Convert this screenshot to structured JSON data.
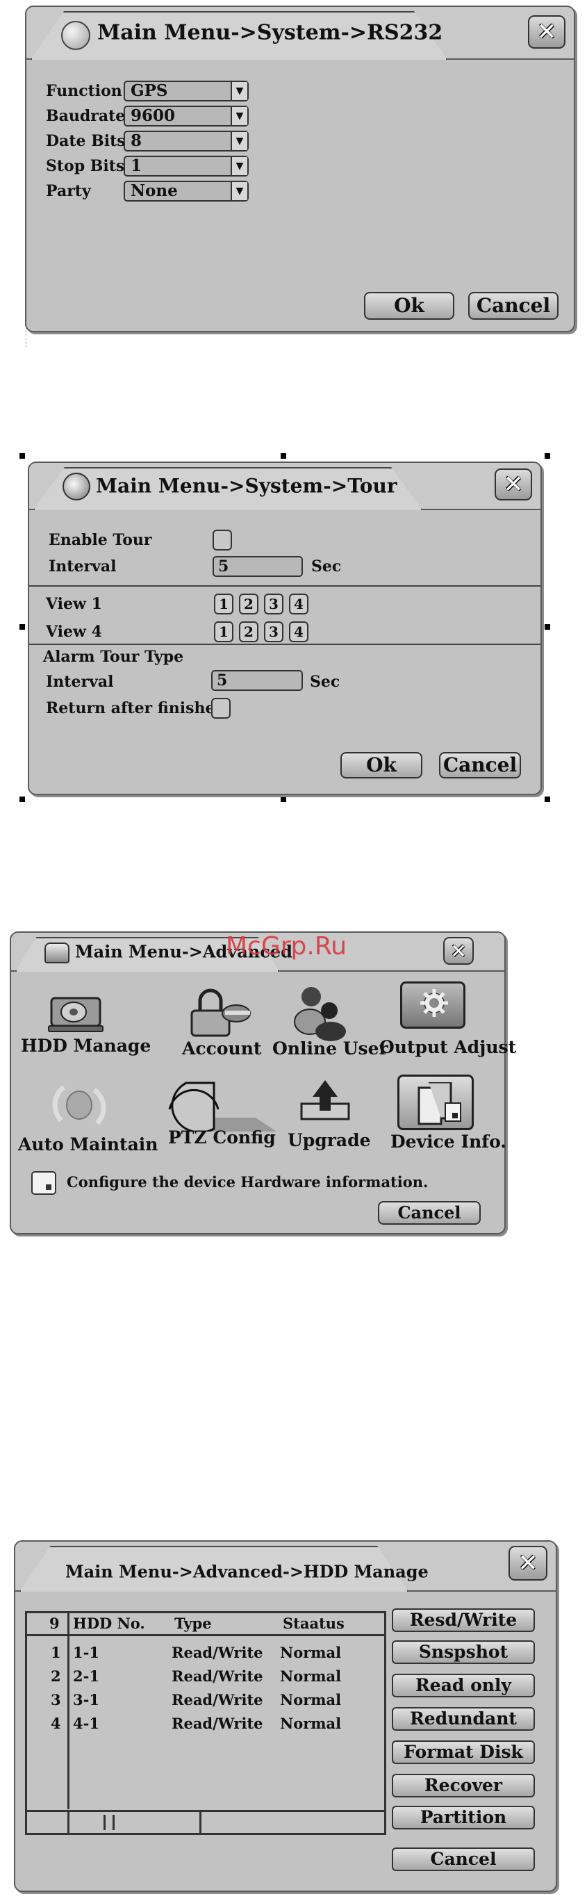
{
  "rs232": {
    "title": "Main Menu->System->RS232",
    "close_symbol": "✕",
    "fields": [
      {
        "label": "Function",
        "value": "GPS"
      },
      {
        "label": "Baudrate",
        "value": "9600"
      },
      {
        "label": "Date Bits",
        "value": "8"
      },
      {
        "label": "Stop Bits",
        "value": "1"
      },
      {
        "label": "Party",
        "value": "None"
      }
    ],
    "ok_label": "Ok",
    "cancel_label": "Cancel"
  },
  "tour": {
    "title": "Main Menu->System->Tour",
    "close_symbol": "✕",
    "enable_tour_label": "Enable Tour",
    "interval_label": "Interval",
    "interval_value": "5",
    "sec_label": "Sec",
    "view1_label": "View 1",
    "view4_label": "View 4",
    "view_numbers": [
      "1",
      "2",
      "3",
      "4"
    ],
    "alarm_tour_label": "Alarm Tour  Type",
    "alarm_interval_label": "Interval",
    "alarm_interval_value": "5",
    "alarm_sec_label": "Sec",
    "return_label": "Return after finished",
    "ok_label": "Ok",
    "cancel_label": "Cancel"
  },
  "advanced": {
    "title": "Main Menu->Advanced",
    "close_symbol": "✕",
    "items": [
      {
        "label": "HDD Manage",
        "icon": "hdd-icon"
      },
      {
        "label": "Account",
        "icon": "account-icon"
      },
      {
        "label": "Online User",
        "icon": "online-user-icon"
      },
      {
        "label": "Output Adjust",
        "icon": "output-adjust-icon"
      },
      {
        "label": "Auto Maintain",
        "icon": "auto-maintain-icon"
      },
      {
        "label": "PTZ Config",
        "icon": "ptz-config-icon"
      },
      {
        "label": "Upgrade",
        "icon": "upgrade-icon"
      },
      {
        "label": "Device Info.",
        "icon": "device-info-icon"
      }
    ],
    "hint": "Configure the device Hardware information.",
    "cancel_label": "Cancel",
    "watermark": "McGrp.Ru"
  },
  "hdd": {
    "title": "Main Menu->Advanced->HDD Manage",
    "close_symbol": "✕",
    "columns": [
      "9",
      "HDD No.",
      "Type",
      "Staatus"
    ],
    "rows": [
      [
        "1",
        "1-1",
        "Read/Write",
        "Normal"
      ],
      [
        "2",
        "2-1",
        "Read/Write",
        "Normal"
      ],
      [
        "3",
        "3-1",
        "Read/Write",
        "Normal"
      ],
      [
        "4",
        "4-1",
        "Read/Write",
        "Normal"
      ]
    ],
    "buttons": [
      "Resd/Write",
      "Snspshot",
      "Read only",
      "Redundant",
      "Format Disk",
      "Recover",
      "Partition"
    ],
    "cancel_label": "Cancel"
  }
}
